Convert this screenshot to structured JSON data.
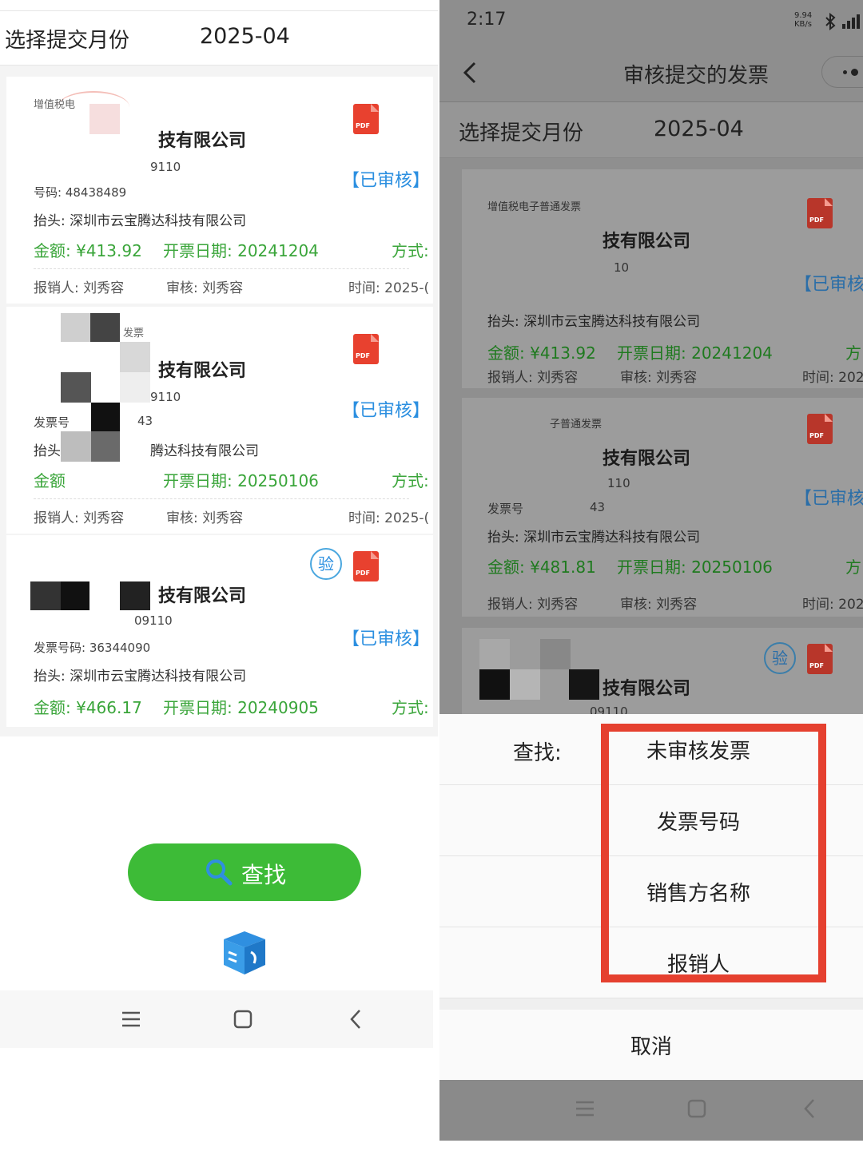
{
  "left": {
    "month_label": "选择提交月份",
    "month_value": "2025-04",
    "cards": [
      {
        "tiny_title": "增值税电",
        "company": "技有限公司",
        "taxid": "9110",
        "invno": "号码: 48438489",
        "payer": "抬头: 深圳市云宝腾达科技有限公司",
        "money": "金额: ¥413.92",
        "date": "开票日期: 20241204",
        "method": "方式:",
        "reimb": "报销人: 刘秀容",
        "reviewer": "审核: 刘秀容",
        "time": "时间: 2025-(",
        "status": "【已审核】",
        "pdf": "PDF"
      },
      {
        "tiny_title": "发票",
        "company": "技有限公司",
        "taxid": "9110",
        "invno": "发票号",
        "invno2": "43",
        "payer": "抬头",
        "payer2": "腾达科技有限公司",
        "money": "金额",
        "date": "开票日期: 20250106",
        "method": "方式:",
        "reimb": "报销人: 刘秀容",
        "reviewer": "审核: 刘秀容",
        "time": "时间: 2025-(",
        "status": "【已审核】",
        "pdf": "PDF"
      },
      {
        "company": "技有限公司",
        "taxid": "09110",
        "invno": "发票号码: 36344090",
        "payer": "抬头: 深圳市云宝腾达科技有限公司",
        "money": "金额: ¥466.17",
        "date": "开票日期: 20240905",
        "method": "方式:",
        "status": "【已审核】",
        "verify": "验",
        "pdf": "PDF"
      }
    ],
    "search_label": "查找"
  },
  "right": {
    "time": "2:17",
    "net_speed": "9.94",
    "net_unit": "KB/s",
    "title": "审核提交的发票",
    "month_label": "选择提交月份",
    "month_value": "2025-04",
    "cards": [
      {
        "tiny_title": "增值税电子普通发票",
        "company": "技有限公司",
        "taxid": "10",
        "payer": "抬头: 深圳市云宝腾达科技有限公司",
        "money": "金额: ¥413.92",
        "date": "开票日期: 20241204",
        "method": "方",
        "reimb": "报销人: 刘秀容",
        "reviewer": "审核: 刘秀容",
        "time": "时间: 202",
        "status": "【已审核",
        "pdf": "PDF"
      },
      {
        "tiny_title": "子普通发票",
        "company": "技有限公司",
        "taxid": "110",
        "invno": "发票号",
        "invno2": "43",
        "payer": "抬头: 深圳市云宝腾达科技有限公司",
        "money": "金额: ¥481.81",
        "date": "开票日期: 20250106",
        "method": "方",
        "reimb": "报销人: 刘秀容",
        "reviewer": "审核: 刘秀容",
        "time": "时间: 202",
        "status": "【已审核",
        "pdf": "PDF"
      },
      {
        "company": "技有限公司",
        "taxid": "09110",
        "verify": "验",
        "pdf": "PDF"
      }
    ],
    "sheet": {
      "find_label": "查找:",
      "options": [
        "未审核发票",
        "发票号码",
        "销售方名称",
        "报销人"
      ],
      "cancel": "取消"
    }
  },
  "colors": {
    "green_button": "#3dbb37",
    "status_blue": "#2b8fe0",
    "money_green": "#3aa53a",
    "highlight_red": "#e5402f"
  }
}
